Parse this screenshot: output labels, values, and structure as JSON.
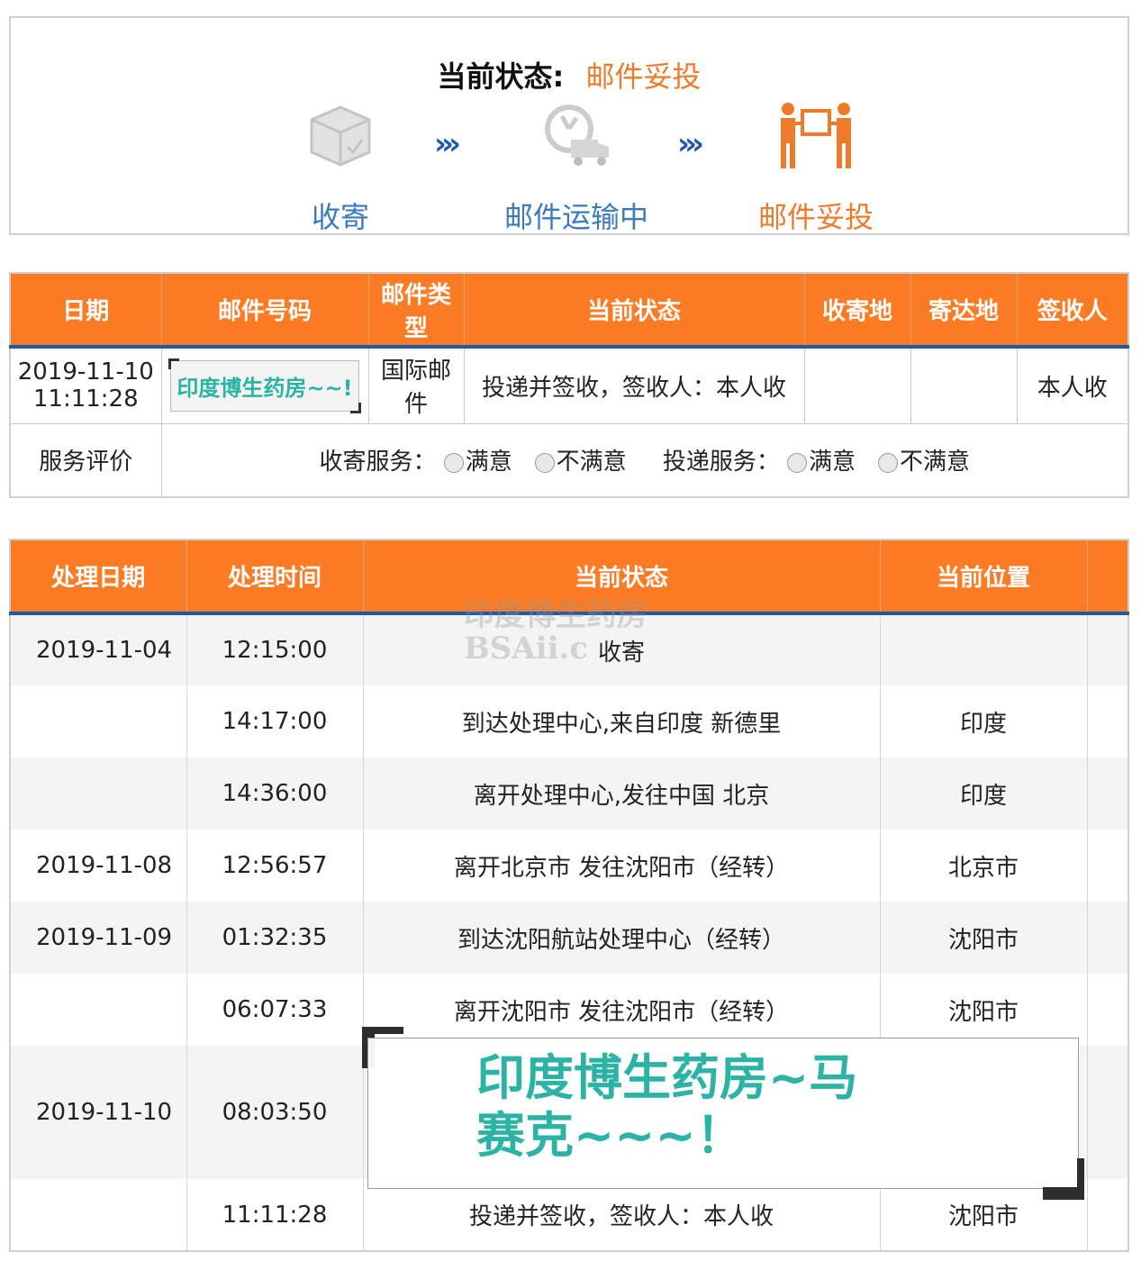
{
  "status_panel": {
    "current_label": "当前状态:",
    "current_value": "邮件妥投",
    "steps": [
      {
        "label": "收寄",
        "icon": "package-icon"
      },
      {
        "label": "邮件运输中",
        "icon": "truck-clock-icon"
      },
      {
        "label": "邮件妥投",
        "icon": "delivery-people-icon"
      }
    ],
    "arrow": "›››"
  },
  "colors": {
    "accent_orange": "#fb7c24",
    "accent_blue": "#1e5aa8",
    "teal": "#2bb3a6"
  },
  "info_table": {
    "headers": [
      "日期",
      "邮件号码",
      "邮件类型",
      "当前状态",
      "收寄地",
      "寄达地",
      "签收人"
    ],
    "row": {
      "date": "2019-11-10 11:11:28",
      "number": "印度博生药房~~!",
      "type": "国际邮件",
      "status": "投递并签收，签收人：本人收",
      "origin": "",
      "destination": "",
      "signer": "本人收"
    },
    "rating": {
      "label": "服务评价",
      "receive_label": "收寄服务：",
      "deliver_label": "投递服务：",
      "satisfied": "满意",
      "unsatisfied": "不满意"
    }
  },
  "track_table": {
    "headers": [
      "处理日期",
      "处理时间",
      "当前状态",
      "当前位置"
    ],
    "rows": [
      {
        "date": "2019-11-04",
        "time": "12:15:00",
        "status": "收寄",
        "location": ""
      },
      {
        "date": "",
        "time": "14:17:00",
        "status": "到达处理中心,来自印度 新德里",
        "location": "印度"
      },
      {
        "date": "",
        "time": "14:36:00",
        "status": "离开处理中心,发往中国 北京",
        "location": "印度"
      },
      {
        "date": "2019-11-08",
        "time": "12:56:57",
        "status": "离开北京市 发往沈阳市（经转）",
        "location": "北京市"
      },
      {
        "date": "2019-11-09",
        "time": "01:32:35",
        "status": "到达沈阳航站处理中心（经转）",
        "location": "沈阳市"
      },
      {
        "date": "",
        "time": "06:07:33",
        "status": "离开沈阳市 发往沈阳市（经转）",
        "location": "沈阳市"
      },
      {
        "date": "2019-11-10",
        "time": "08:03:50",
        "status": "",
        "location": ""
      },
      {
        "date": "",
        "time": "11:11:28",
        "status": "投递并签收，签收人：本人收",
        "location": "沈阳市"
      }
    ]
  },
  "watermark": {
    "line1": "印度博生药房",
    "line2": "BSAii.c"
  },
  "overlay": {
    "line1": "印度博生药房~马",
    "line2": "赛克~~~！"
  }
}
